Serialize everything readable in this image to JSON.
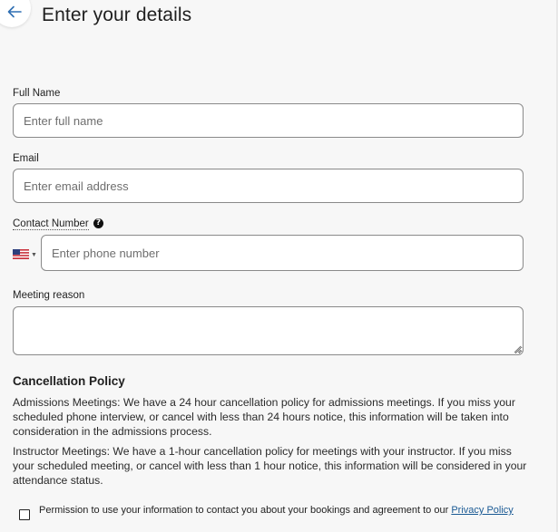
{
  "header": {
    "title": "Enter your details",
    "back_icon": "arrow-left-icon",
    "accent_color": "#2f6fb3"
  },
  "form": {
    "full_name": {
      "label": "Full Name",
      "placeholder": "Enter full name",
      "value": ""
    },
    "email": {
      "label": "Email",
      "placeholder": "Enter email address",
      "value": ""
    },
    "contact": {
      "label": "Contact Number",
      "help_icon": "question-circle-icon",
      "country": "US",
      "country_icon": "us-flag-icon",
      "placeholder": "Enter phone number",
      "value": ""
    },
    "meeting_reason": {
      "label": "Meeting reason",
      "value": ""
    }
  },
  "policy": {
    "heading": "Cancellation Policy",
    "admissions": "Admissions Meetings: We have a 24 hour cancellation policy for admissions meetings. If you miss your scheduled phone interview, or cancel with less than 24 hours notice, this information will be taken into consideration in the admissions process.",
    "instructor": "Instructor Meetings: We have a 1-hour cancellation policy for meetings with your instructor. If you miss your scheduled meeting, or cancel with less than 1 hour notice, this information will be considered in your attendance status."
  },
  "consent": {
    "checked": false,
    "text": "Permission to use your information to contact you about your bookings and agreement to our ",
    "link": "Privacy Policy"
  }
}
